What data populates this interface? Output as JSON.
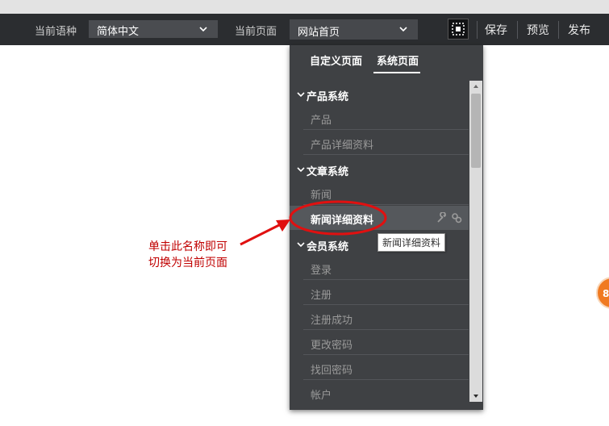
{
  "toolbar": {
    "language_label": "当前语种",
    "language_value": "简体中文",
    "page_label": "当前页面",
    "page_value": "网站首页",
    "save_label": "保存",
    "preview_label": "预览",
    "publish_label": "发布"
  },
  "dropdown": {
    "tabs": [
      {
        "label": "自定义页面",
        "active": false
      },
      {
        "label": "系统页面",
        "active": true
      }
    ],
    "groups": [
      {
        "title": "产品系统",
        "items": [
          "产品",
          "产品详细资料"
        ]
      },
      {
        "title": "文章系统",
        "items": [
          "新闻",
          "新闻详细资料"
        ]
      },
      {
        "title": "会员系统",
        "items": [
          "登录",
          "注册",
          "注册成功",
          "更改密码",
          "找回密码",
          "帐户"
        ]
      }
    ],
    "active_item": "新闻详细资料",
    "tooltip": "新闻详细资料"
  },
  "annotation": {
    "line1": "单击此名称即可",
    "line2": "切换为当前页面"
  },
  "badge": {
    "text": "8"
  },
  "colors": {
    "toolbar_bg": "#2b2d30",
    "dropdown_bg": "#3f4144",
    "annotation_red": "#e01010",
    "badge_orange": "#f07a21"
  }
}
